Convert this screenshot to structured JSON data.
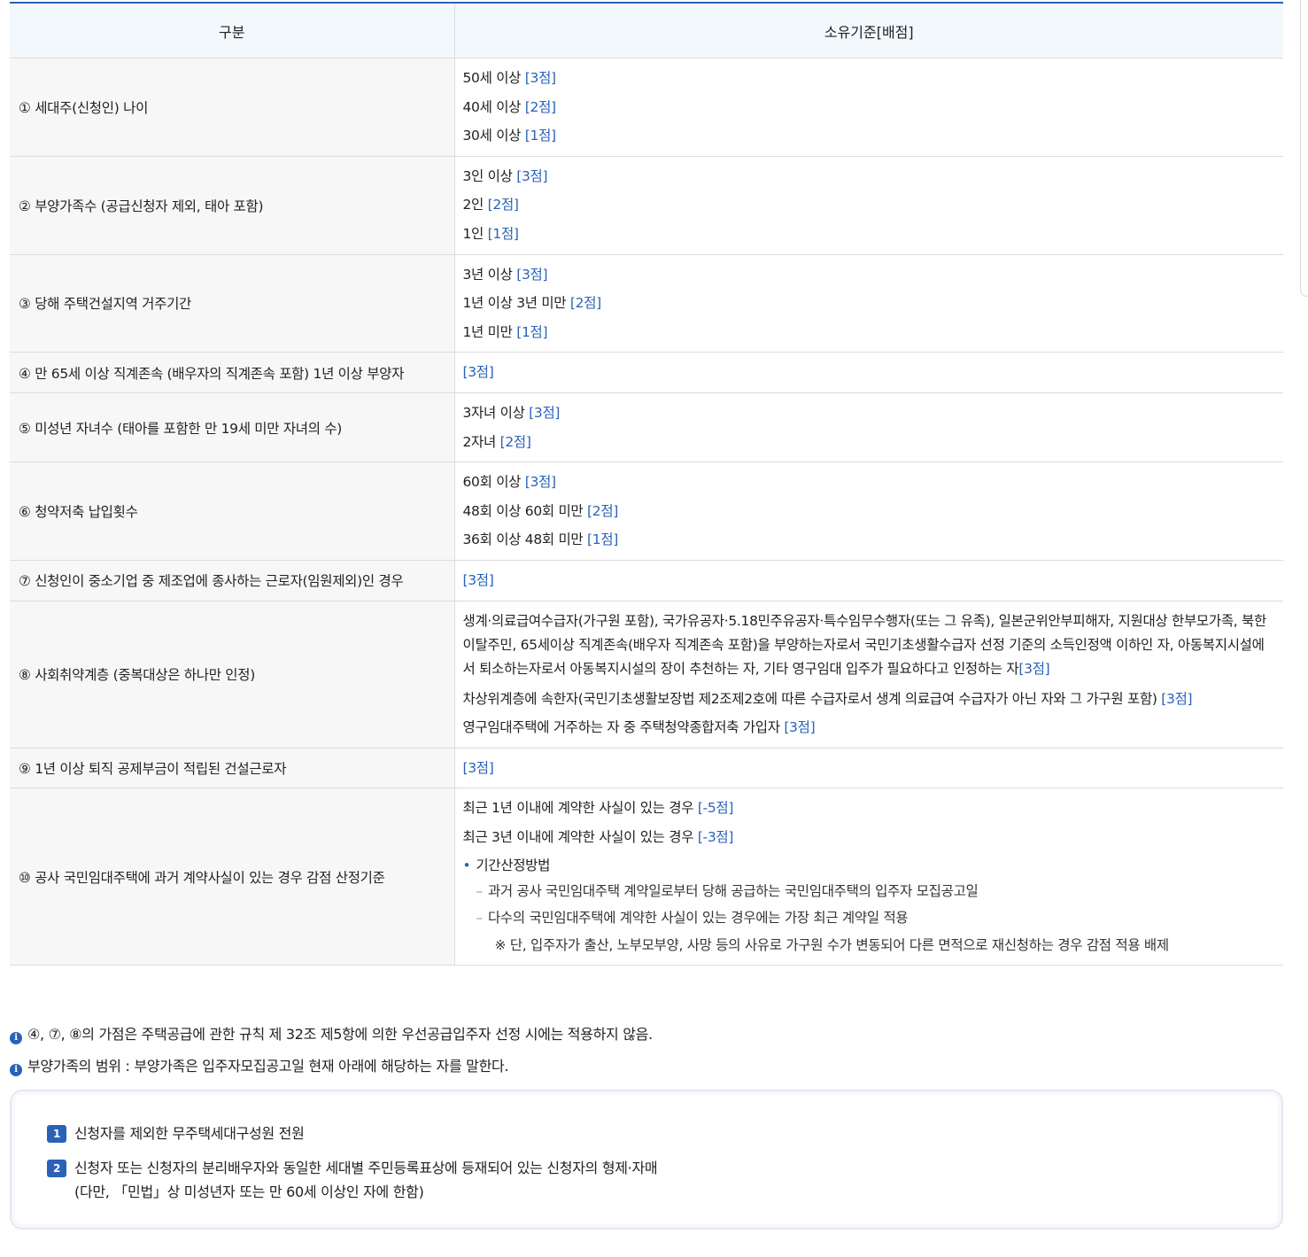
{
  "table": {
    "headers": [
      "구분",
      "소유기준[배점]"
    ],
    "rows": [
      {
        "category": "① 세대주(신청인) 나이",
        "items": [
          {
            "text": "50세 이상 ",
            "points": "[3점]"
          },
          {
            "text": "40세 이상 ",
            "points": "[2점]"
          },
          {
            "text": "30세 이상 ",
            "points": "[1점]"
          }
        ]
      },
      {
        "category": "② 부양가족수 (공급신청자 제외, 태아 포함)",
        "items": [
          {
            "text": "3인 이상 ",
            "points": "[3점]"
          },
          {
            "text": "2인 ",
            "points": "[2점]"
          },
          {
            "text": "1인 ",
            "points": "[1점]"
          }
        ]
      },
      {
        "category": "③ 당해 주택건설지역 거주기간",
        "items": [
          {
            "text": "3년 이상 ",
            "points": "[3점]"
          },
          {
            "text": "1년 이상 3년 미만 ",
            "points": "[2점]"
          },
          {
            "text": "1년 미만 ",
            "points": "[1점]"
          }
        ]
      },
      {
        "category": "④ 만 65세 이상 직계존속 (배우자의 직계존속 포함) 1년 이상 부양자",
        "items": [
          {
            "text": "",
            "points": "[3점]"
          }
        ]
      },
      {
        "category": "⑤ 미성년 자녀수 (태아를 포함한 만 19세 미만 자녀의 수)",
        "items": [
          {
            "text": "3자녀 이상 ",
            "points": "[3점]"
          },
          {
            "text": "2자녀 ",
            "points": "[2점]"
          }
        ]
      },
      {
        "category": "⑥ 청약저축 납입횟수",
        "items": [
          {
            "text": "60회 이상 ",
            "points": "[3점]"
          },
          {
            "text": "48회 이상 60회 미만 ",
            "points": "[2점]"
          },
          {
            "text": "36회 이상 48회 미만 ",
            "points": "[1점]"
          }
        ]
      },
      {
        "category": "⑦ 신청인이 중소기업 중 제조업에 종사하는 근로자(임원제외)인 경우",
        "items": [
          {
            "text": "",
            "points": "[3점]"
          }
        ]
      },
      {
        "category": "⑧ 사회취약계층 (중복대상은 하나만 인정)",
        "items": [
          {
            "text": "생계·의료급여수급자(가구원 포함), 국가유공자·5.18민주유공자·특수임무수행자(또는 그 유족), 일본군위안부피해자, 지원대상 한부모가족, 북한이탈주민, 65세이상 직계존속(배우자 직계존속 포함)을 부양하는자로서 국민기초생활수급자 선정 기준의 소득인정액 이하인 자, 아동복지시설에서 퇴소하는자로서 아동복지시설의 장이 추천하는 자, 기타 영구임대 입주가 필요하다고 인정하는 자",
            "points": "[3점]"
          },
          {
            "text": "차상위계층에 속한자(국민기초생활보장법 제2조제2호에 따른 수급자로서 생계 의료급여 수급자가 아닌 자와 그 가구원 포함) ",
            "points": "[3점]"
          },
          {
            "text": "영구임대주택에 거주하는 자 중 주택청약종합저축 가입자 ",
            "points": "[3점]"
          }
        ]
      },
      {
        "category": "⑨ 1년 이상 퇴직 공제부금이 적립된 건설근로자",
        "items": [
          {
            "text": "",
            "points": "[3점]"
          }
        ]
      },
      {
        "category": "⑩ 공사 국민임대주택에 과거 계약사실이 있는 경우 감점 산정기준",
        "items": [
          {
            "text": "최근 1년 이내에 계약한 사실이 있는 경우 ",
            "points": "[-5점]"
          },
          {
            "text": "최근 3년 이내에 계약한 사실이 있는 경우 ",
            "points": "[-3점]"
          }
        ],
        "method": {
          "bullet": "•",
          "title": "기간산정방법",
          "dash": "–",
          "lines": [
            "과거 공사 국민임대주택 계약일로부터 당해 공급하는 국민임대주택의 입주자 모집공고일",
            "다수의 국민임대주택에 계약한 사실이 있는 경우에는 가장 최근 계약일 적용"
          ],
          "note": "※ 단, 입주자가 출산, 노부모부양, 사망 등의 사유로 가구원 수가 변동되어 다른 면적으로 재신청하는 경우 감점 적용 배제"
        }
      }
    ]
  },
  "notes": [
    {
      "icon": "info-icon",
      "glyph": "i",
      "text": "④, ⑦, ⑧의 가점은 주택공급에 관한 규칙 제 32조 제5항에 의한 우선공급입주자 선정 시에는 적용하지 않음."
    },
    {
      "icon": "info-icon",
      "glyph": "i",
      "text": "부양가족의 범위 : 부양가족은 입주자모집공고일 현재 아래에 해당하는 자를 말한다."
    }
  ],
  "box": {
    "items": [
      {
        "num": "1",
        "lines": [
          "신청자를 제외한 무주택세대구성원 전원"
        ]
      },
      {
        "num": "2",
        "lines": [
          "신청자 또는 신청자의 분리배우자와 동일한 세대별 주민등록표상에 등재되어 있는 신청자의 형제·자매",
          "(다만, 「민법」상 미성년자 또는 만 60세 이상인 자에 한함)"
        ]
      }
    ]
  },
  "colors": {
    "accent": "#2a62b8",
    "header_bg": "#f3f8fc",
    "category_bg": "#f7f7f7",
    "border": "#dcdcdc"
  }
}
